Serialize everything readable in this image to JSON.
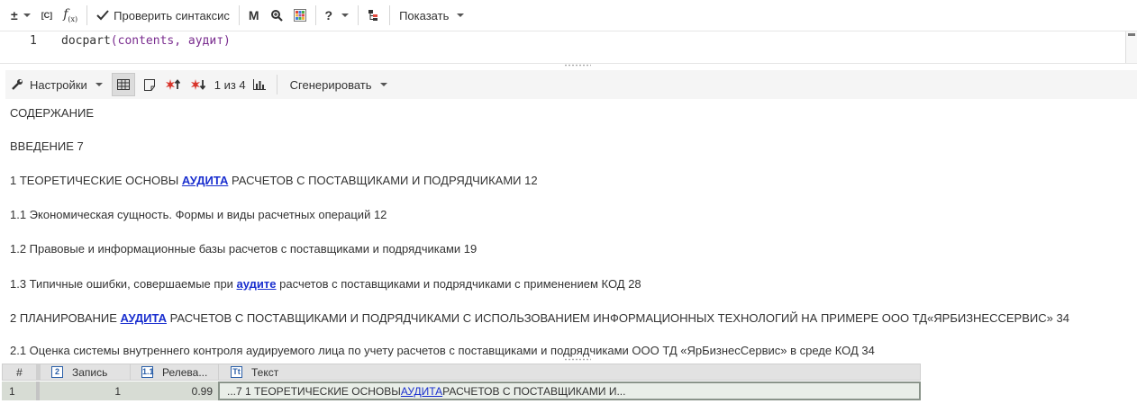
{
  "toolbar": {
    "plusminus_label": "±",
    "c_label": "[C]",
    "fx_label": "f",
    "fx_sub": "(x)",
    "check_syntax_label": "Проверить синтаксис",
    "m_label": "M",
    "help_label": "?",
    "show_label": "Показать"
  },
  "editor": {
    "line_number": "1",
    "code_fn": "docpart",
    "code_args": "(contents, аудит)"
  },
  "result_toolbar": {
    "settings_label": "Настройки",
    "pager_text": "1 из 4",
    "generate_label": "Сгенерировать"
  },
  "document": {
    "lines": [
      {
        "pre": "СОДЕРЖАНИЕ",
        "hl": "",
        "post": ""
      },
      {
        "pre": "ВВЕДЕНИЕ 7",
        "hl": "",
        "post": ""
      },
      {
        "pre": "1 ТЕОРЕТИЧЕСКИЕ ОСНОВЫ ",
        "hl": "АУДИТА",
        "post": " РАСЧЕТОВ С ПОСТАВЩИКАМИ И ПОДРЯДЧИКАМИ 12"
      },
      {
        "pre": "1.1 Экономическая сущность. Формы и виды расчетных операций 12",
        "hl": "",
        "post": ""
      },
      {
        "pre": "1.2 Правовые и информационные базы расчетов с поставщиками и подрядчиками 19",
        "hl": "",
        "post": ""
      },
      {
        "pre": "1.3 Типичные ошибки, совершаемые при ",
        "hl": "аудите",
        "post": " расчетов с поставщиками и подрядчиками с применением КОД 28"
      },
      {
        "pre": "2 ПЛАНИРОВАНИЕ ",
        "hl": "АУДИТА",
        "post": " РАСЧЕТОВ С ПОСТАВЩИКАМИ И ПОДРЯДЧИКАМИ С ИСПОЛЬЗОВАНИЕМ ИНФОРМАЦИОННЫХ ТЕХНОЛОГИЙ НА ПРИМЕРЕ ООО ТД«ЯРБИЗНЕССЕРВИС» 34"
      },
      {
        "pre": "2.1 Оценка системы внутреннего контроля аудируемого лица по учету расчетов с поставщиками и подрядчиками ООО ТД «ЯрБизнесСервис» в среде КОД 34",
        "hl": "",
        "post": ""
      }
    ]
  },
  "table": {
    "headers": {
      "index": "#",
      "record_type": "2",
      "record": "Запись",
      "relevance_type": "1.1",
      "relevance": "Релева...",
      "text_type": "Tt",
      "text": "Текст"
    },
    "row": {
      "index": "1",
      "record": "1",
      "relevance": "0.99",
      "text_pre": "...7 1 ТЕОРЕТИЧЕСКИЕ ОСНОВЫ ",
      "text_link": "АУДИТА",
      "text_post": " РАСЧЕТОВ С ПОСТАВЩИКАМИ И..."
    }
  }
}
